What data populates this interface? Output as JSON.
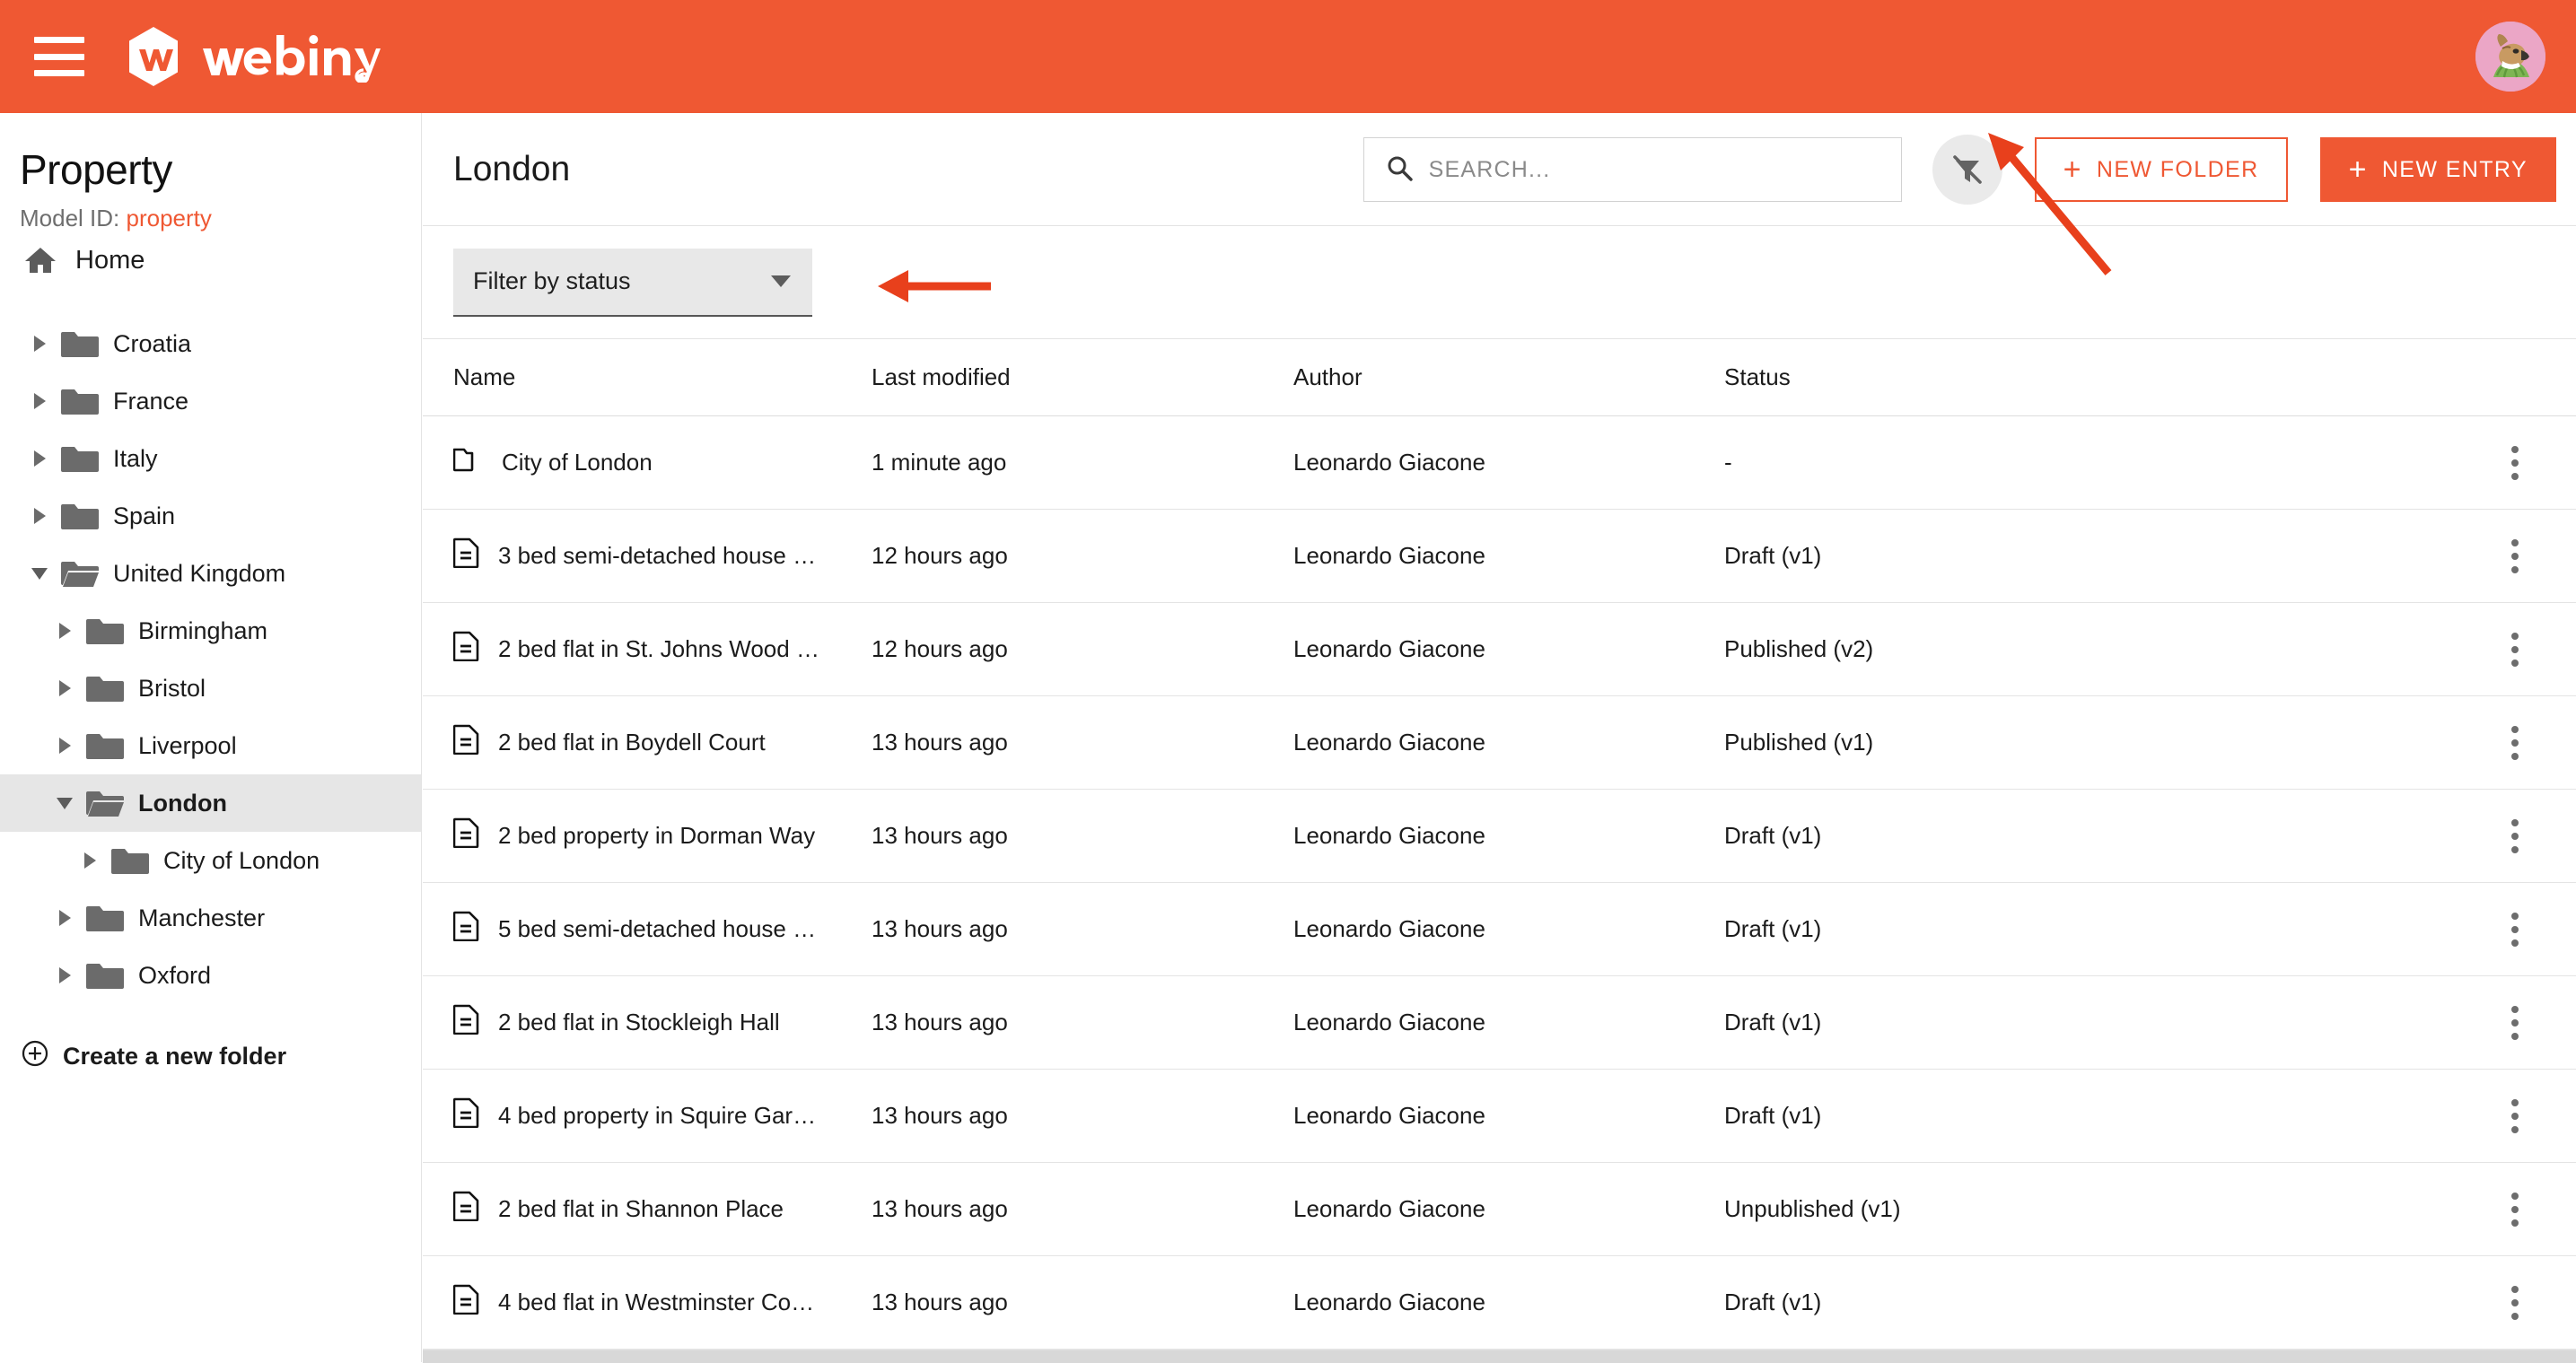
{
  "topbar": {
    "menu_icon": "hamburger-icon",
    "brand_name": "webiny",
    "avatar_icon": "user-avatar"
  },
  "sidebar": {
    "title": "Property",
    "model_id_label": "Model ID:",
    "model_id_value": "property",
    "home_label": "Home",
    "tree": [
      {
        "label": "Croatia",
        "level": 1,
        "expanded": false,
        "selected": false
      },
      {
        "label": "France",
        "level": 1,
        "expanded": false,
        "selected": false
      },
      {
        "label": "Italy",
        "level": 1,
        "expanded": false,
        "selected": false
      },
      {
        "label": "Spain",
        "level": 1,
        "expanded": false,
        "selected": false
      },
      {
        "label": "United Kingdom",
        "level": 1,
        "expanded": true,
        "selected": false
      },
      {
        "label": "Birmingham",
        "level": 2,
        "expanded": false,
        "selected": false
      },
      {
        "label": "Bristol",
        "level": 2,
        "expanded": false,
        "selected": false
      },
      {
        "label": "Liverpool",
        "level": 2,
        "expanded": false,
        "selected": false
      },
      {
        "label": "London",
        "level": 2,
        "expanded": true,
        "selected": true
      },
      {
        "label": "City of London",
        "level": 3,
        "expanded": false,
        "selected": false
      },
      {
        "label": "Manchester",
        "level": 2,
        "expanded": false,
        "selected": false
      },
      {
        "label": "Oxford",
        "level": 2,
        "expanded": false,
        "selected": false
      }
    ],
    "create_folder_label": "Create a new folder"
  },
  "main": {
    "page_title": "London",
    "search": {
      "placeholder": "SEARCH...",
      "value": "",
      "icon": "search-icon"
    },
    "filter_toggle": {
      "icon": "filter-off-icon"
    },
    "new_folder_button": {
      "plus": "+",
      "label": "NEW FOLDER"
    },
    "new_entry_button": {
      "plus": "+",
      "label": "NEW ENTRY"
    },
    "status_filter": {
      "label": "Filter by status",
      "icon": "chevron-down-icon"
    },
    "columns": [
      "Name",
      "Last modified",
      "Author",
      "Status"
    ],
    "rows": [
      {
        "name": "City of London",
        "icon": "folder-icon",
        "modified": "1 minute ago",
        "author": "Leonardo Giacone",
        "status": "-"
      },
      {
        "name": "3 bed semi-detached house …",
        "icon": "document-icon",
        "modified": "12 hours ago",
        "author": "Leonardo Giacone",
        "status": "Draft (v1)"
      },
      {
        "name": "2 bed flat in St. Johns Wood …",
        "icon": "document-icon",
        "modified": "12 hours ago",
        "author": "Leonardo Giacone",
        "status": "Published (v2)"
      },
      {
        "name": "2 bed flat in Boydell Court",
        "icon": "document-icon",
        "modified": "13 hours ago",
        "author": "Leonardo Giacone",
        "status": "Published (v1)"
      },
      {
        "name": "2 bed property in Dorman Way",
        "icon": "document-icon",
        "modified": "13 hours ago",
        "author": "Leonardo Giacone",
        "status": "Draft (v1)"
      },
      {
        "name": "5 bed semi-detached house …",
        "icon": "document-icon",
        "modified": "13 hours ago",
        "author": "Leonardo Giacone",
        "status": "Draft (v1)"
      },
      {
        "name": "2 bed flat in Stockleigh Hall",
        "icon": "document-icon",
        "modified": "13 hours ago",
        "author": "Leonardo Giacone",
        "status": "Draft (v1)"
      },
      {
        "name": "4 bed property in Squire Gar…",
        "icon": "document-icon",
        "modified": "13 hours ago",
        "author": "Leonardo Giacone",
        "status": "Draft (v1)"
      },
      {
        "name": "2 bed flat in Shannon Place",
        "icon": "document-icon",
        "modified": "13 hours ago",
        "author": "Leonardo Giacone",
        "status": "Unpublished (v1)"
      },
      {
        "name": "4 bed flat in Westminster Co…",
        "icon": "document-icon",
        "modified": "13 hours ago",
        "author": "Leonardo Giacone",
        "status": "Draft (v1)"
      }
    ]
  },
  "annotations": [
    {
      "name": "arrow-to-status-filter",
      "color": "#e8401c"
    },
    {
      "name": "arrow-to-filter-toggle",
      "color": "#e8401c"
    }
  ],
  "colors": {
    "brand_orange": "#ef5833",
    "annotation_red": "#e8401c",
    "selected_row": "#e6e6e6",
    "folder_gray": "#6b6b6b"
  }
}
